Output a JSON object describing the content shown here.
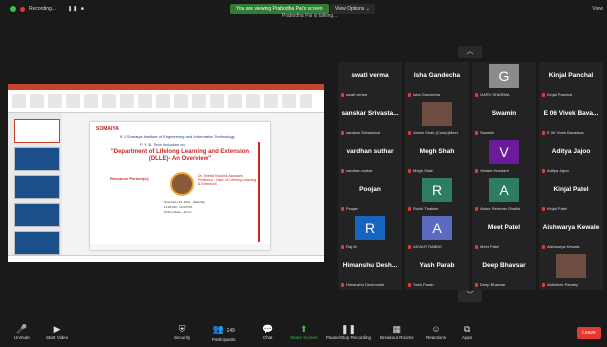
{
  "topbar": {
    "recording_label": "Recording...",
    "pause_stop": "❚❚  ■",
    "banner": "You are viewing Prabodha Pai's screen",
    "view_options": "View Options ⌄",
    "talking": "Prabodha Pai is talking...",
    "view_button": "View"
  },
  "slide": {
    "university": "SOMAIYA",
    "line1": "K J Somaiya Institute of Engineering and Information Technology",
    "program": "F. Y. B. Tech Induction  on",
    "title": "\"Department of Lifelong Learning and Extension (DLLE)- An Overview\"",
    "resource_person": "Resource Person(s):",
    "speaker": "Dr. Shefali Kaushik Assistant Professor - Dept. of Lifelong Learning & Extension",
    "info": "November 23, 2021 · Saturday\n11:00 AM - 12:00 PM\nOnline Mode - Zoom"
  },
  "gallery": {
    "tiles": [
      {
        "name": "swati verma",
        "caption": "swati verma"
      },
      {
        "name": "Isha Gandecha",
        "caption": "Isha Gandecha"
      },
      {
        "name": "G",
        "caption": "GARV SHARMA",
        "avatar_letter": "G",
        "avatar_color": "#8c8c8c"
      },
      {
        "name": "Kinjal Panchal",
        "caption": "Kinjal Panchal"
      },
      {
        "name": "sanskar Srivasta...",
        "caption": "sanskar Srivastava"
      },
      {
        "name": "",
        "caption": "Vansh Shah (Comp)Meet",
        "photo": true
      },
      {
        "name": "Swamin",
        "caption": "Swamin"
      },
      {
        "name": "E 06 Vivek Bava...",
        "caption": "E 06 Vivek Bavaskar"
      },
      {
        "name": "vardhan suthar",
        "caption": "vardhan suthar"
      },
      {
        "name": "Megh Shah",
        "caption": "Megh Shah"
      },
      {
        "name": "V",
        "caption": "Vedant Hundare",
        "avatar_letter": "V",
        "avatar_color": "#6a1b9a"
      },
      {
        "name": "Aditya Jajoo",
        "caption": "Aditya Jajoo"
      },
      {
        "name": "Poojan",
        "caption": "Poojan"
      },
      {
        "name": "R",
        "caption": "Ruchi Thakker",
        "avatar_letter": "R",
        "avatar_color": "#2e7d62"
      },
      {
        "name": "A",
        "caption": "Abdur Rehman Shaikh",
        "avatar_letter": "A",
        "avatar_color": "#2e7d62"
      },
      {
        "name": "Kinjal Patel",
        "caption": "Kinjal Patel"
      },
      {
        "name": "R",
        "caption": "Raj M.",
        "avatar_letter": "R",
        "avatar_color": "#1565c0"
      },
      {
        "name": "A",
        "caption": "ADVAIT RABDE",
        "avatar_letter": "A",
        "avatar_color": "#5c6bc0"
      },
      {
        "name": "Meet Patel",
        "caption": "Meet Patel"
      },
      {
        "name": "Aishwarya Kewale",
        "caption": "Aishwarya Kewale"
      },
      {
        "name": "Himanshu  Desh...",
        "caption": "Himanshu Deshmukh"
      },
      {
        "name": "Yash Parab",
        "caption": "Yash Parab"
      },
      {
        "name": "Deep Bhavsar",
        "caption": "Deep Bhavsar"
      },
      {
        "name": "",
        "caption": "Abhishek Pandey",
        "photo": true
      }
    ]
  },
  "toolbar": {
    "unmute": "Unmute",
    "start_video": "Start Video",
    "security": "Security",
    "participants": "Participants",
    "participants_count": "149",
    "chat": "Chat",
    "share_screen": "Share Screen",
    "pause_stop_recording": "Pause/Stop Recording",
    "breakout_rooms": "Breakout Rooms",
    "reactions": "Reactions",
    "apps": "Apps",
    "leave": "Leave"
  },
  "colors": {
    "accent_green": "#3fb950",
    "leave_red": "#e53935",
    "slide_red": "#c62828"
  }
}
